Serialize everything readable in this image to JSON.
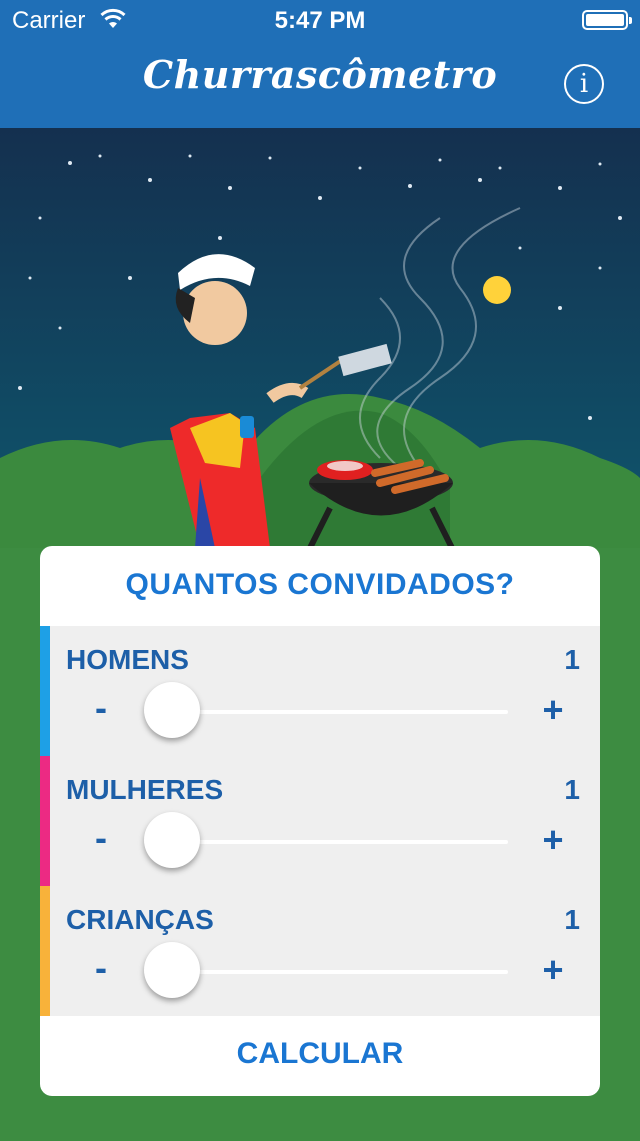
{
  "status_bar": {
    "carrier": "Carrier",
    "time": "5:47 PM",
    "wifi_icon": "wifi-icon",
    "battery_icon": "battery-icon"
  },
  "nav": {
    "title": "Churrascômetro",
    "info_icon": "info-icon",
    "info_label": "i"
  },
  "illustration": {
    "description_icon": "barbecue-illustration"
  },
  "form": {
    "title": "QUANTOS CONVIDADOS?",
    "rows": [
      {
        "label": "HOMENS",
        "count": "1",
        "minus": "-",
        "plus": "+",
        "accent": "#1ea0e6",
        "level": 0
      },
      {
        "label": "MULHERES",
        "count": "1",
        "minus": "-",
        "plus": "+",
        "accent": "#ec2a83",
        "level": 0
      },
      {
        "label": "CRIANÇAS",
        "count": "1",
        "minus": "-",
        "plus": "+",
        "accent": "#f8b23a",
        "level": 0
      }
    ],
    "submit_label": "CALCULAR"
  },
  "colors": {
    "nav_bg": "#1f6fb7",
    "accent_blue": "#1a76d2",
    "grass": "#3d8c41",
    "sky": "#123454"
  }
}
